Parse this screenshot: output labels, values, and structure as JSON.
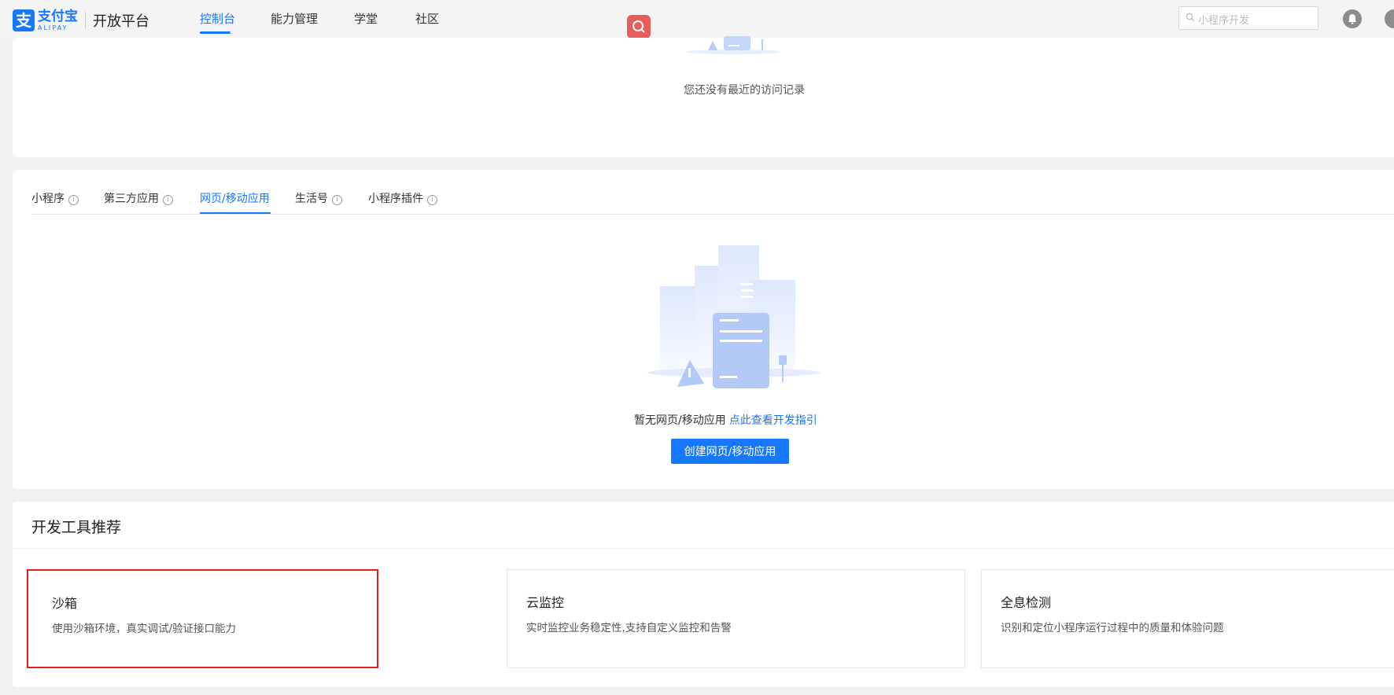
{
  "header": {
    "logo": {
      "brand_cn": "支付宝",
      "brand_en": "ALIPAY",
      "platform": "开放平台"
    },
    "nav": [
      {
        "label": "控制台",
        "active": true
      },
      {
        "label": "能力管理",
        "active": false
      },
      {
        "label": "学堂",
        "active": false
      },
      {
        "label": "社区",
        "active": false
      }
    ],
    "search": {
      "placeholder": "小程序开发"
    }
  },
  "recent": {
    "empty_text": "您还没有最近的访问记录"
  },
  "apps": {
    "tabs": [
      {
        "label": "小程序",
        "info": true,
        "active": false
      },
      {
        "label": "第三方应用",
        "info": true,
        "active": false
      },
      {
        "label": "网页/移动应用",
        "info": false,
        "active": true
      },
      {
        "label": "生活号",
        "info": true,
        "active": false
      },
      {
        "label": "小程序插件",
        "info": true,
        "active": false
      }
    ],
    "empty_text": "暂无网页/移动应用",
    "guide_link": "点此查看开发指引",
    "create_button": "创建网页/移动应用"
  },
  "tools": {
    "title": "开发工具推荐",
    "items": [
      {
        "name": "沙箱",
        "desc": "使用沙箱环境，真实调试/验证接口能力",
        "highlighted": true
      },
      {
        "name": "云监控",
        "desc": "实时监控业务稳定性,支持自定义监控和告警",
        "highlighted": false
      },
      {
        "name": "全息检测",
        "desc": "识别和定位小程序运行过程中的质量和体验问题",
        "highlighted": false
      }
    ]
  },
  "colors": {
    "primary": "#1677ff",
    "highlight_border": "#e02020",
    "float_button": "#e85c5c"
  },
  "icons": [
    "search-icon",
    "bell-icon",
    "info-icon",
    "empty-illustration"
  ]
}
